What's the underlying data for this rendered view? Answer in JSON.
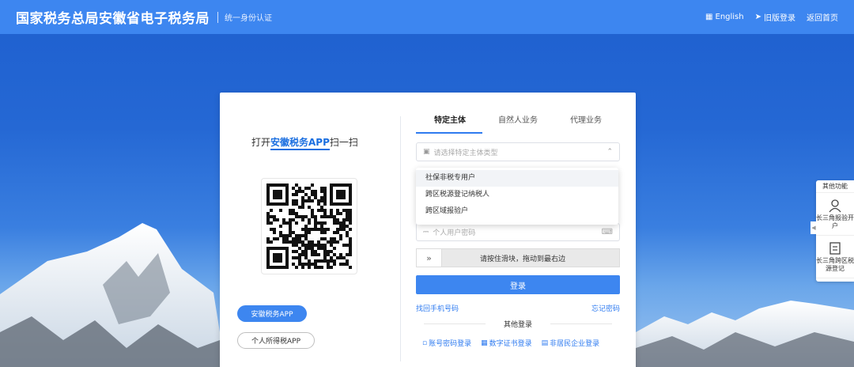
{
  "header": {
    "title": "国家税务总局安徽省电子税务局",
    "subtitle": "统一身份认证",
    "links": [
      {
        "label": "English",
        "icon": "translate-icon"
      },
      {
        "label": "旧版登录",
        "icon": "send-icon"
      },
      {
        "label": "返回首页",
        "icon": ""
      }
    ]
  },
  "left": {
    "scan_prefix": "打开",
    "scan_app": "安徽税务APP",
    "scan_suffix": "扫一扫",
    "app_primary": "安徽税务APP",
    "app_secondary": "个人所得税APP"
  },
  "tabs": [
    "特定主体",
    "自然人业务",
    "代理业务"
  ],
  "form": {
    "select_placeholder": "请选择特定主体类型",
    "options": [
      "社保非税专用户",
      "跨区税源登记纳税人",
      "跨区域报验户"
    ],
    "password_placeholder": "个人用户密码",
    "slider_text": "请按住滑块，拖动到最右边",
    "login_label": "登录",
    "forgot_phone": "找回手机号码",
    "forgot_password": "忘记密码",
    "other_title": "其他登录",
    "other_options": [
      {
        "label": "账号密码登录",
        "icon": "user-lock-icon"
      },
      {
        "label": "数字证书登录",
        "icon": "certificate-icon"
      },
      {
        "label": "非居民企业登录",
        "icon": "building-icon"
      }
    ]
  },
  "side": {
    "title": "其他功能",
    "items": [
      "长三角报验开户",
      "长三角跨区税源登记"
    ]
  },
  "colors": {
    "primary": "#3d86f0",
    "header": "#3d86f0",
    "link": "#2f7bf0"
  }
}
